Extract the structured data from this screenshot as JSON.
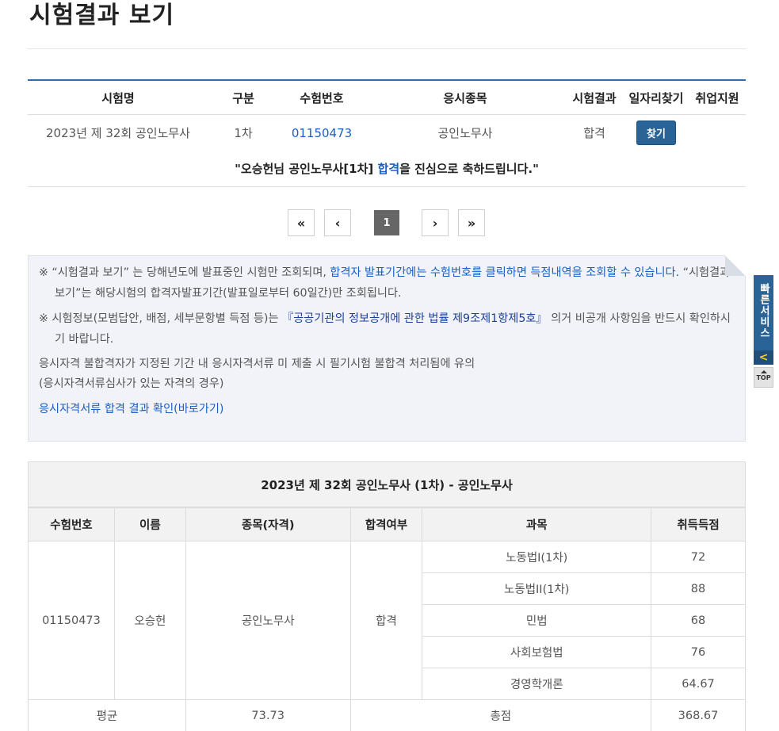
{
  "page": {
    "title": "시험결과 보기"
  },
  "results": {
    "headers": [
      "시험명",
      "구분",
      "수험번호",
      "응시종목",
      "시험결과",
      "일자리찾기",
      "취업지원"
    ],
    "row": {
      "exam_name": "2023년 제 32회 공인노무사",
      "category": "1차",
      "exam_number": "01150473",
      "subject": "공인노무사",
      "result": "합격",
      "find_button": "찾기"
    },
    "congrats": {
      "before": "\"오승헌님 공인노무사[1차] ",
      "highlight": "합격",
      "after": "을 진심으로 축하드립니다.\""
    }
  },
  "pagination": {
    "first": "«",
    "prev": "‹",
    "current": "1",
    "next": "›",
    "last": "»"
  },
  "notice": {
    "p1_a": "※ “시험결과 보기” 는 당해년도에 발표중인 시험만 조회되며, ",
    "p1_link": "합격자 발표기간에는 수험번호를 클릭하면 득점내역을 조회할 수 있습니다.",
    "p1_b": " “시험결과보기”는 해당시험의 합격자발표기간(발표일로부터 60일간)만 조회됩니다.",
    "p2_a": "※ 시험정보(모범답안, 배점, 세부문항별 득점 등)는 ",
    "p2_link": "『공공기관의 정보공개에 관한 법률 제9조제1항제5호』",
    "p2_b": " 의거 비공개 사항임을 반드시 확인하시기 바랍니다.",
    "p3_line1": "응시자격 불합격자가 지정된 기간 내 응시자격서류 미 제출 시 필기시험 불합격 처리됨에 유의",
    "p3_line2": "(응시자격서류심사가 있는 자격의 경우)",
    "p4_link": "응시자격서류 합격 결과 확인(바로가기)"
  },
  "score": {
    "title": "2023년 제 32회 공인노무사 (1차) - 공인노무사",
    "headers": [
      "수험번호",
      "이름",
      "종목(자격)",
      "합격여부",
      "과목",
      "취득득점"
    ],
    "exam_number": "01150473",
    "name": "오승헌",
    "qualification": "공인노무사",
    "pass": "합격",
    "subjects": [
      {
        "name": "노동법I(1차)",
        "score": "72"
      },
      {
        "name": "노동법II(1차)",
        "score": "88"
      },
      {
        "name": "민법",
        "score": "68"
      },
      {
        "name": "사회보험법",
        "score": "76"
      },
      {
        "name": "경영학개론",
        "score": "64.67"
      }
    ],
    "average_label": "평균",
    "average_value": "73.73",
    "total_label": "총점",
    "total_value": "368.67"
  },
  "side": {
    "quick_label": "빠른서비스",
    "collapse": "<",
    "top_label": "TOP"
  }
}
